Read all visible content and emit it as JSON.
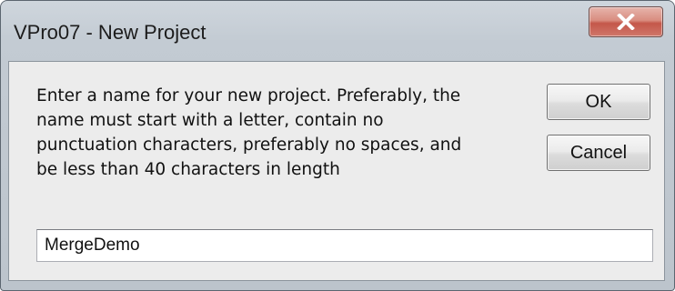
{
  "window": {
    "title": "VPro07 - New Project",
    "close_icon": "close-x-icon"
  },
  "dialog": {
    "message": "Enter a name for your new project.  Preferably, the\nname must start with a letter, contain no\npunctuation characters, preferably no spaces, and\nbe less than 40 characters in length",
    "ok_label": "OK",
    "cancel_label": "Cancel",
    "project_name_value": "MergeDemo",
    "project_name_placeholder": ""
  },
  "colors": {
    "close_button_accent": "#c4574a",
    "frame": "#bcc4cc",
    "client_background": "#ececec"
  }
}
